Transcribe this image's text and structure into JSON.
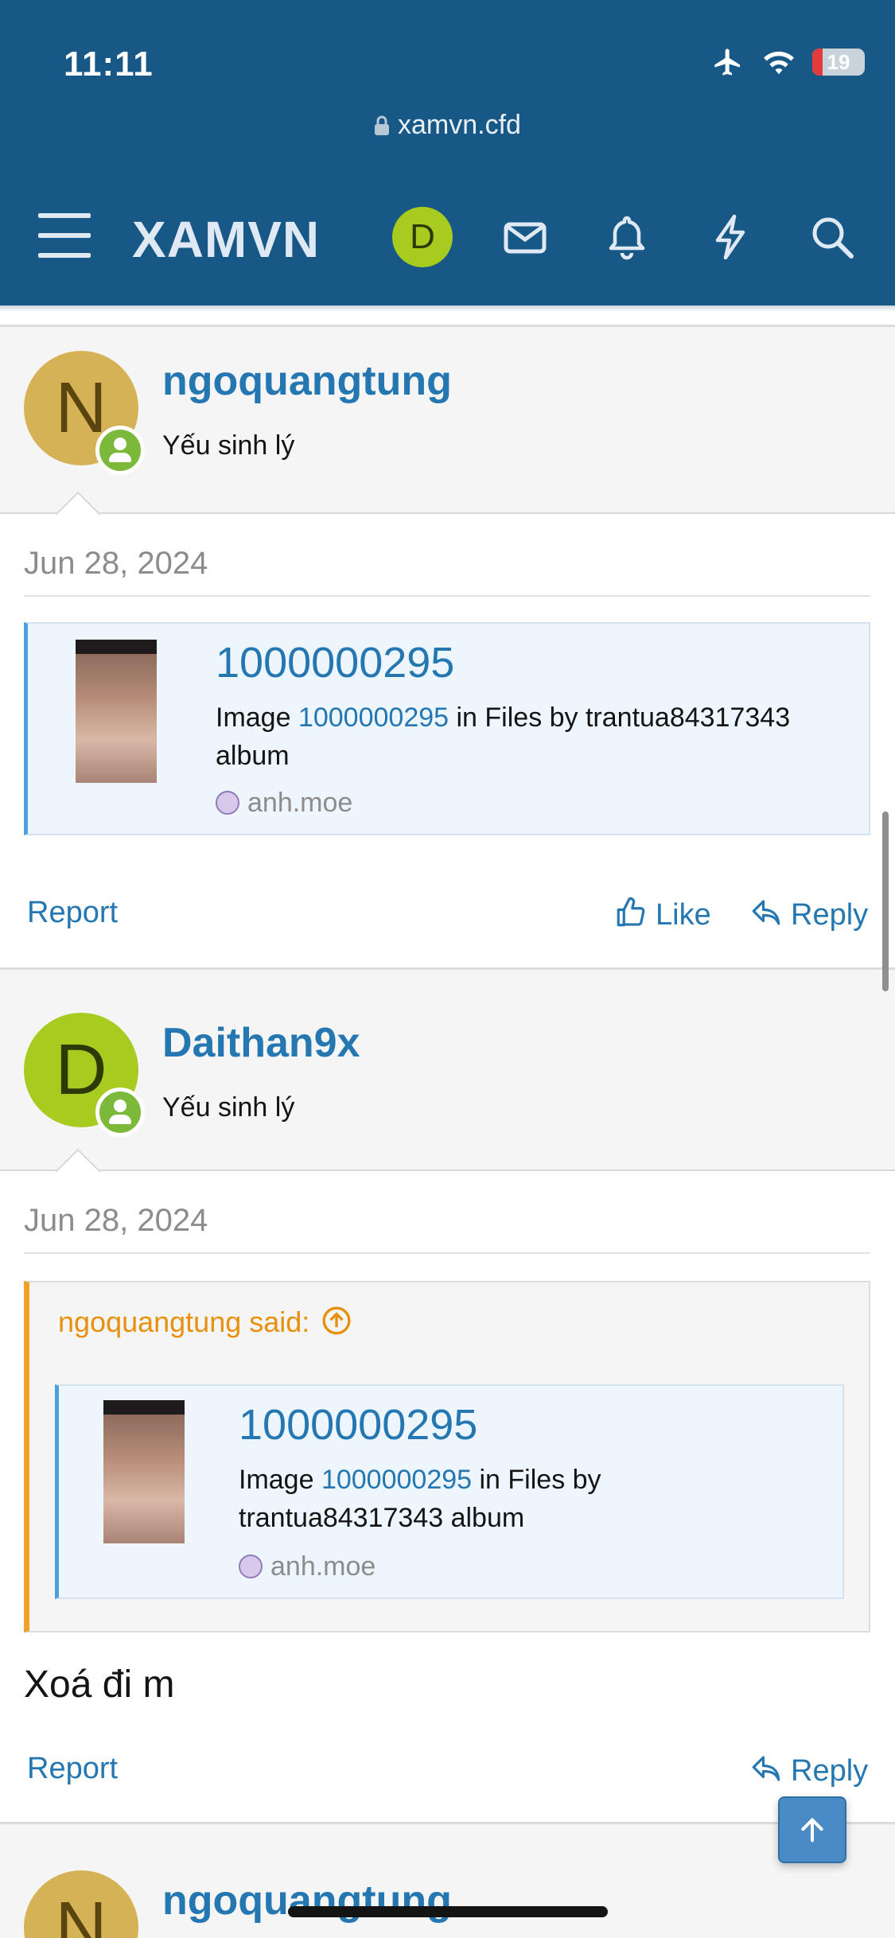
{
  "status_bar": {
    "time": "11:11",
    "battery": "19",
    "battery_level": 0.19
  },
  "browser": {
    "url": "xamvn.cfd"
  },
  "nav": {
    "logo": "XAMVN",
    "avatar_letter": "D"
  },
  "posts": [
    {
      "author": "ngoquangtung",
      "avatar_letter": "N",
      "avatar_color": "#d6b257",
      "user_title": "Yếu sinh lý",
      "date": "Jun 28, 2024",
      "embed": {
        "title": "1000000295",
        "desc_prefix": "Image ",
        "desc_link": "1000000295",
        "desc_suffix": " in Files by trantua84317343 album",
        "site": "anh.moe"
      },
      "actions": {
        "report": "Report",
        "like": "Like",
        "reply": "Reply"
      }
    },
    {
      "author": "Daithan9x",
      "avatar_letter": "D",
      "avatar_color": "#a7cb1e",
      "user_title": "Yếu sinh lý",
      "date": "Jun 28, 2024",
      "quote": {
        "header": "ngoquangtung said:",
        "embed": {
          "title": "1000000295",
          "desc_prefix": "Image ",
          "desc_link": "1000000295",
          "desc_suffix": " in Files by trantua84317343 album",
          "site": "anh.moe"
        }
      },
      "message": "Xoá đi m",
      "actions": {
        "report": "Report",
        "reply": "Reply"
      }
    },
    {
      "author": "ngoquangtung",
      "avatar_letter": "N",
      "avatar_color": "#d6b257"
    }
  ],
  "colors": {
    "header": "#185886",
    "link": "#2577b1",
    "quote_accent": "#f0a12a",
    "embed_accent": "#4ba0e0"
  }
}
